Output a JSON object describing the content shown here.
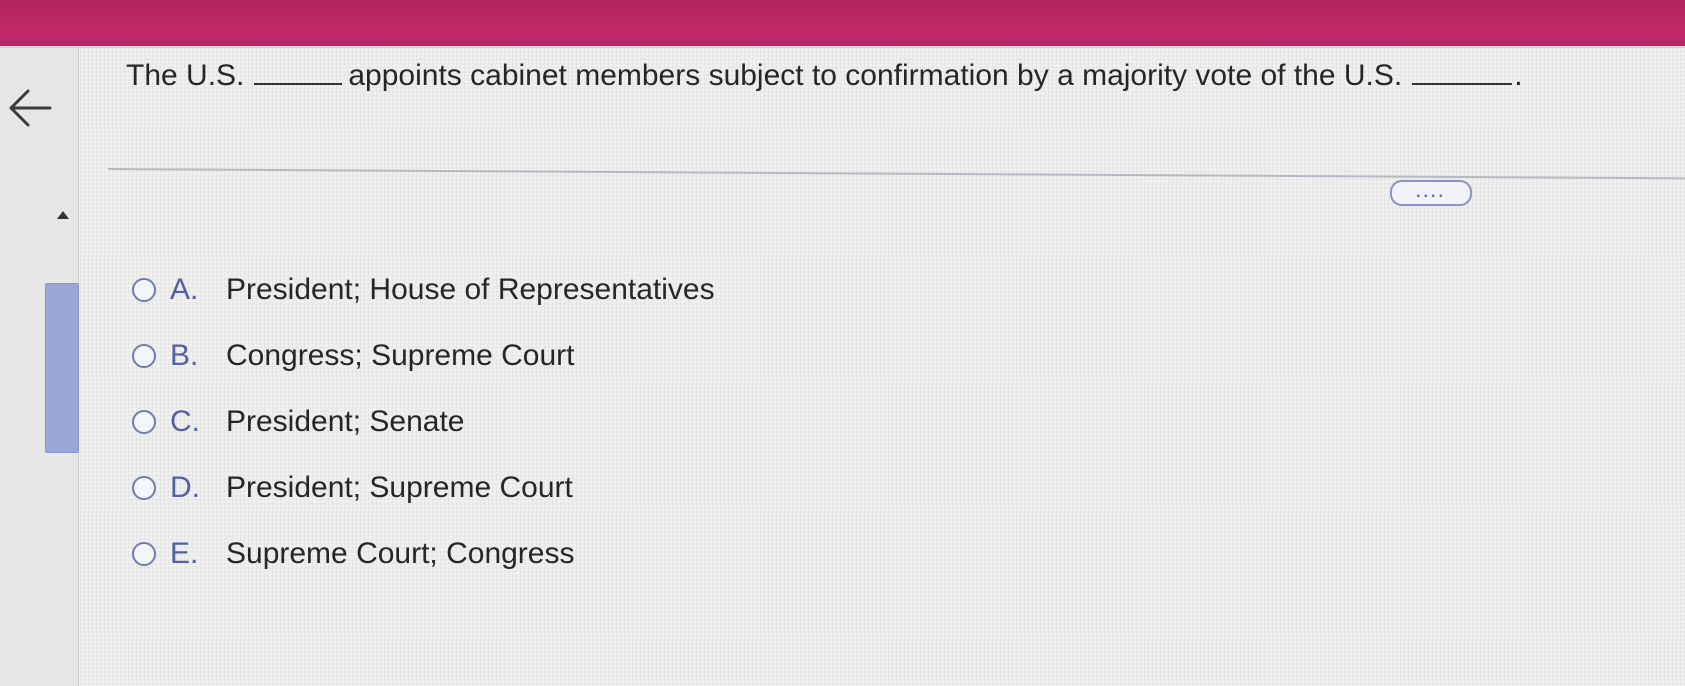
{
  "question": {
    "part1": "The U.S.",
    "part2": "appoints cabinet members subject to confirmation by a majority vote of the U.S.",
    "part3": "."
  },
  "icons": {
    "back": "arrow-left-icon",
    "scroll_up": "triangle-up-icon",
    "expand": "ellipsis-icon"
  },
  "expand_label": "....",
  "options": [
    {
      "letter": "A.",
      "text": "President; House of Representatives"
    },
    {
      "letter": "B.",
      "text": "Congress; Supreme Court"
    },
    {
      "letter": "C.",
      "text": "President; Senate"
    },
    {
      "letter": "D.",
      "text": "President; Supreme Court"
    },
    {
      "letter": "E.",
      "text": "Supreme Court; Congress"
    }
  ],
  "colors": {
    "top_bar": "#c02868",
    "accent": "#5560a0",
    "scroll_thumb": "#9aa6d8"
  }
}
